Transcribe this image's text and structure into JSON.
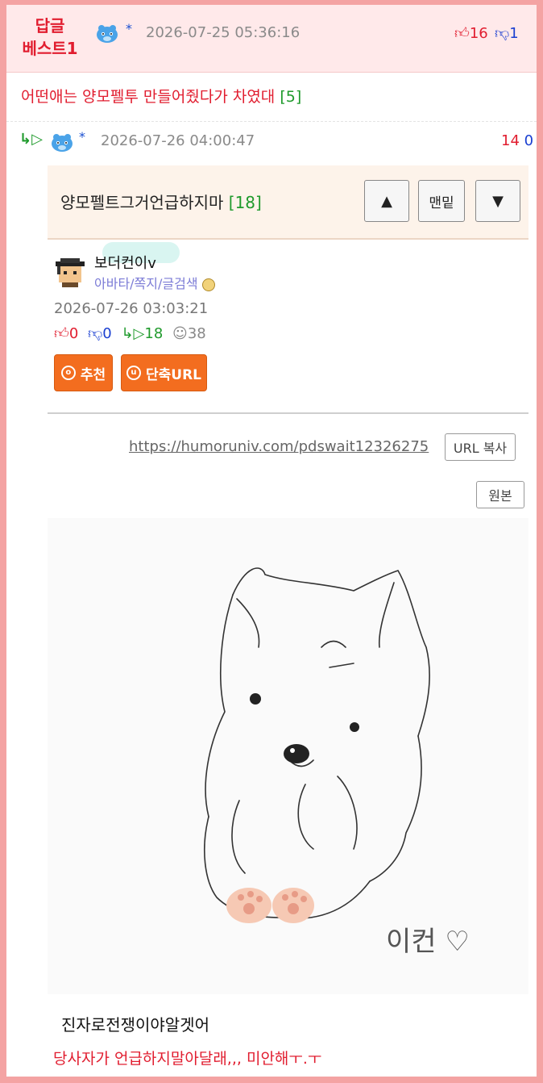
{
  "best_comment": {
    "label_line1": "답글",
    "label_line2": "베스트1",
    "star": "*",
    "date": "2026-07-25 05:36:16",
    "up": "16",
    "down": "1",
    "title": "어떤애는 양모펠투 만들어줬다가 차였대",
    "reply_count": "[5]"
  },
  "reply": {
    "star": "*",
    "date": "2026-07-26 04:00:47",
    "up": "14",
    "down": "0"
  },
  "post": {
    "title": "양모펠트그거언급하지마",
    "reply_count": "[18]",
    "nav_up": "▲",
    "nav_bottom": "맨밑",
    "nav_down": "▼",
    "author": "보더컨이v",
    "author_links": "아바타/쪽지/글검색",
    "date": "2026-07-26 03:03:21",
    "stat_up": "0",
    "stat_down": "0",
    "stat_reply": "18",
    "stat_view": "38",
    "recommend_btn": "추천",
    "short_url_btn": "단축URL",
    "url": "https://humoruniv.com/pdswait12326275",
    "url_copy_btn": "URL 복사",
    "original_btn": "원본",
    "caption1": "진자로전쟁이야알겟어",
    "caption2": "당사자가 언급하지말아달래,,, 미안해ㅜ.ㅜ"
  },
  "drawing_signature": "이컨 ♡",
  "colors": {
    "frame": "#f4a3a3",
    "best_bg": "#ffe9ea",
    "accent_red": "#e11d2f",
    "accent_green": "#1f9a2c",
    "orange": "#f36d1f"
  }
}
